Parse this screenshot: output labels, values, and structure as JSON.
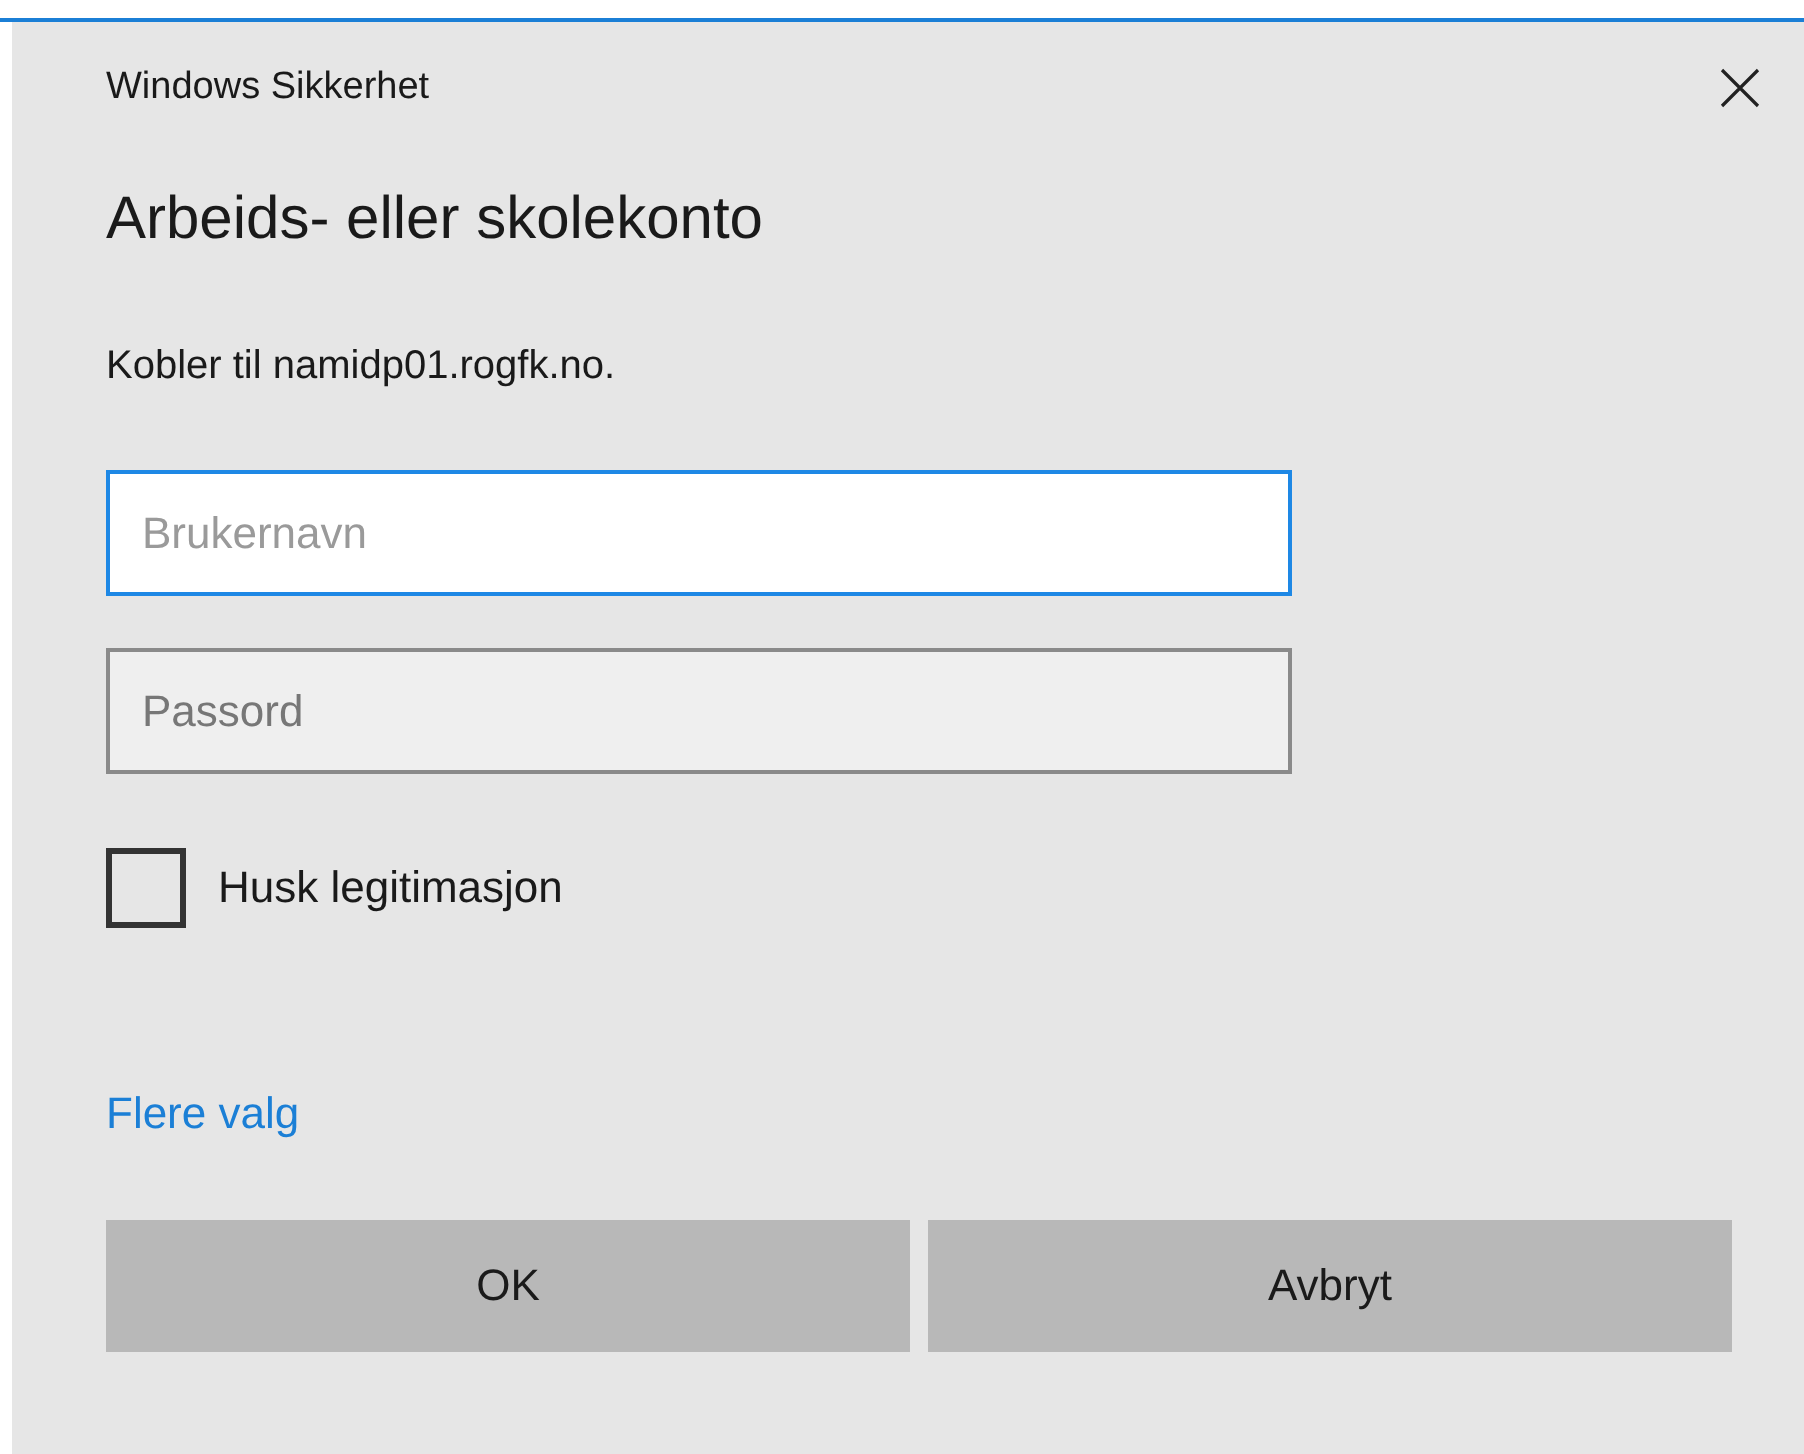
{
  "window": {
    "title": "Windows Sikkerhet"
  },
  "heading": "Arbeids- eller skolekonto",
  "message": "Kobler til namidp01.rogfk.no.",
  "fields": [
    {
      "placeholder": "Brukernavn",
      "focused": true
    },
    {
      "placeholder": "Passord",
      "focused": false
    }
  ],
  "remember": {
    "label": "Husk legitimasjon",
    "checked": false
  },
  "more_link": "Flere valg",
  "buttons": [
    {
      "label": "OK"
    },
    {
      "label": "Avbryt"
    }
  ]
}
